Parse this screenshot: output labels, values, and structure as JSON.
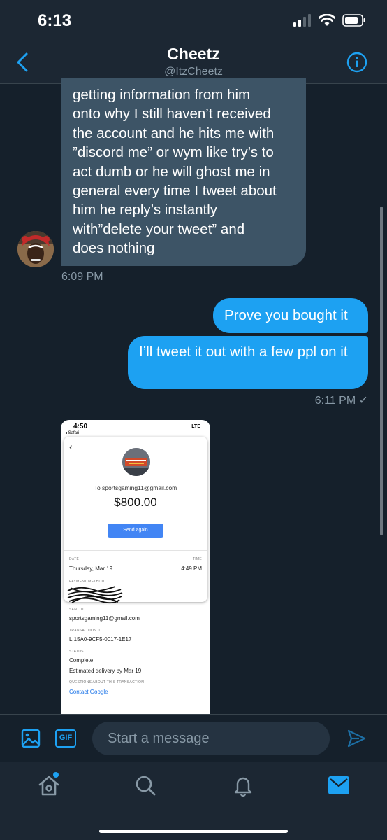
{
  "status_bar": {
    "time": "6:13"
  },
  "header": {
    "name": "Cheetz",
    "handle": "@ItzCheetz"
  },
  "conversation": {
    "incoming_message": {
      "lines": [
        "getting information from him",
        "onto why I still haven’t received",
        "the account and he hits me with",
        "”discord me” or wym like try’s to",
        "act dumb or he will ghost me in",
        "general every time I tweet about",
        "him he reply’s instantly",
        "with”delete your tweet” and",
        "does nothing"
      ],
      "time": "6:09 PM"
    },
    "outgoing_messages": [
      {
        "text": "Prove you bought it"
      },
      {
        "text": "I’ll tweet it out with a few ppl on it"
      }
    ],
    "outgoing_time": "6:11 PM ✓",
    "image_message": {
      "status_time": "4:50",
      "back_app": "◂ Safari",
      "network": "LTE",
      "recipient_line": "To sportsgaming11@gmail.com",
      "amount": "$800.00",
      "send_again": "Send again",
      "date_label": "DATE",
      "date_value": "Thursday, Mar 19",
      "time_label": "TIME",
      "time_value": "4:49 PM",
      "payment_method_label": "PAYMENT METHOD",
      "sent_to_label": "SENT TO",
      "sent_to_value": "sportsgaming11@gmail.com",
      "transaction_id_label": "TRANSACTION ID",
      "transaction_id_value": "L.15A0-9CF5-0017-1E17",
      "status_label": "STATUS",
      "status_value": "Complete",
      "delivery": "Estimated delivery by Mar 19",
      "questions_label": "QUESTIONS ABOUT THIS TRANSACTION",
      "contact_link": "Contact Google"
    }
  },
  "composer": {
    "placeholder": "Start a message",
    "gif_label": "GIF"
  },
  "colors": {
    "background": "#15202b",
    "bar": "#1c2733",
    "accent": "#1da1f2",
    "incoming_bubble": "#3d5466",
    "muted_text": "#8899a6"
  },
  "icons": {
    "header": [
      "back-chevron-icon",
      "info-icon"
    ],
    "composer": [
      "image-icon",
      "gif-icon",
      "send-icon"
    ],
    "tabs": [
      "home-icon",
      "search-icon",
      "notifications-icon",
      "messages-icon"
    ]
  }
}
